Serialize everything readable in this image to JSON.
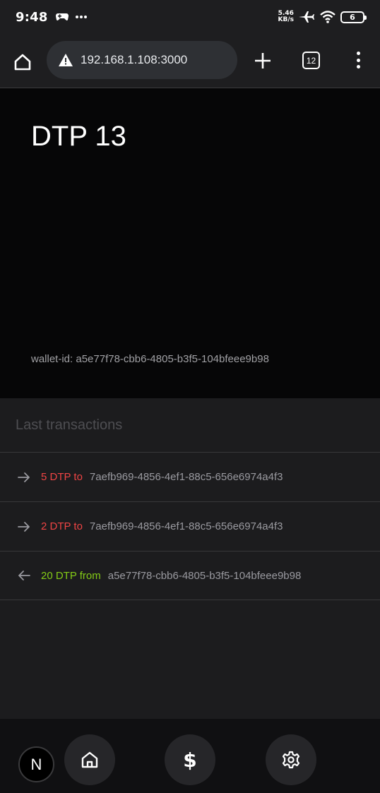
{
  "status_bar": {
    "time": "9:48",
    "net_speed_value": "5.46",
    "net_speed_unit": "KB/s",
    "battery_level": "6",
    "icons": [
      "game-controller-icon",
      "more-dots-icon",
      "airplane-icon",
      "wifi-icon",
      "battery-icon"
    ]
  },
  "browser": {
    "url": "192.168.1.108:3000",
    "security_icon": "warning-triangle-icon",
    "tab_count": "12"
  },
  "wallet": {
    "balance": "DTP 13",
    "wallet_id_text": "wallet-id: a5e77f78-cbb6-4805-b3f5-104bfeee9b98"
  },
  "transactions": {
    "heading": "Last transactions",
    "items": [
      {
        "direction": "out",
        "amount_text": "5 DTP to",
        "peer": "7aefb969-4856-4ef1-88c5-656e6974a4f3",
        "color": "#ef4444"
      },
      {
        "direction": "out",
        "amount_text": "2 DTP to",
        "peer": "7aefb969-4856-4ef1-88c5-656e6974a4f3",
        "color": "#ef4444"
      },
      {
        "direction": "in",
        "amount_text": "20 DTP from",
        "peer": "a5e77f78-cbb6-4805-b3f5-104bfeee9b98",
        "color": "#84cc16"
      }
    ]
  },
  "bottom_nav": {
    "dev_badge": "N",
    "dollar_glyph": "$",
    "items": [
      "home-icon",
      "dollar-icon",
      "gear-icon"
    ]
  },
  "colors": {
    "outgoing": "#ef4444",
    "incoming": "#84cc16",
    "panel_dark": "#060607",
    "panel": "#1c1c1e"
  }
}
